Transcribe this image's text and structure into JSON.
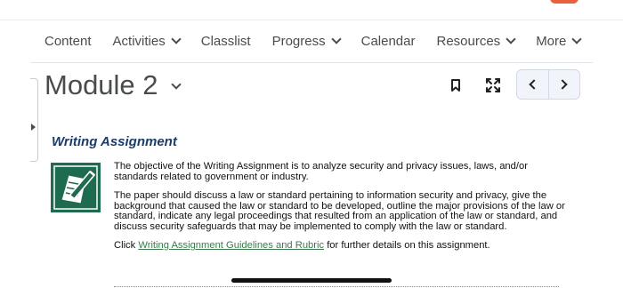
{
  "nav": {
    "items": [
      {
        "label": "Content",
        "has_menu": false
      },
      {
        "label": "Activities",
        "has_menu": true
      },
      {
        "label": "Classlist",
        "has_menu": false
      },
      {
        "label": "Progress",
        "has_menu": true
      },
      {
        "label": "Calendar",
        "has_menu": false
      },
      {
        "label": "Resources",
        "has_menu": true
      },
      {
        "label": "More",
        "has_menu": true
      }
    ]
  },
  "module": {
    "title": "Module 2"
  },
  "toolbar": {
    "icons": [
      "bookmark-icon",
      "fullscreen-icon",
      "chevron-left-icon",
      "chevron-right-icon"
    ]
  },
  "section": {
    "title": "Writing Assignment",
    "icon": "assignment-pencil-icon",
    "paragraphs": [
      "The objective of the Writing Assignment is to analyze security and privacy issues, laws, and/or standards related to government or industry.",
      "The paper should discuss a law or standard pertaining to information security and privacy, give the background that caused the law or standard to be developed, outline the major provisions of the law or standard, indicate any legal proceedings that resulted from an application of the law or standard, and discuss security safeguards that may be implemented to comply with the law or standard."
    ],
    "link_prefix": "Click ",
    "link_text": "Writing Assignment Guidelines and Rubric",
    "link_suffix": " for further details on this assignment."
  },
  "colors": {
    "accent": "#e8603c",
    "title_blue": "#1a3c6b",
    "icon_green": "#1f6b4f",
    "link": "#3a7a4a"
  }
}
